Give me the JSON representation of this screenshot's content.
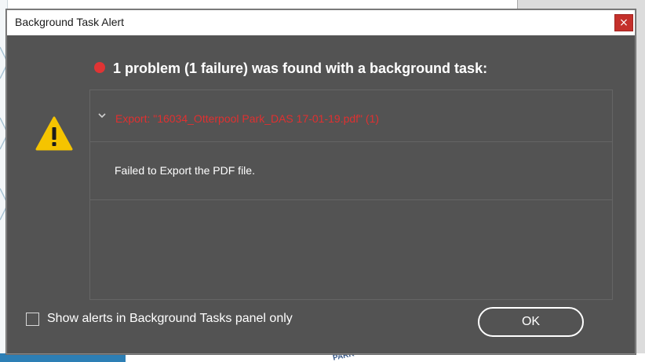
{
  "dialog": {
    "title": "Background Task Alert",
    "close_label": "×",
    "summary": "1 problem (1 failure) was found with a background task:",
    "issue": {
      "title": "Export: \"16034_Otterpool Park_DAS 17-01-19.pdf\" (1)",
      "detail": "Failed to Export the PDF file."
    },
    "checkbox_label": "Show alerts in Background Tasks panel only",
    "checkbox_checked": false,
    "ok_label": "OK"
  },
  "colors": {
    "dialog_bg": "#535353",
    "error_red": "#e03030",
    "warning_yellow": "#f5c400",
    "close_red": "#c4302b"
  },
  "icons": {
    "warning": "warning-triangle-icon",
    "status": "red-dot-icon",
    "expand": "chevron-down-icon"
  },
  "background": {
    "park_text": "PARK"
  }
}
